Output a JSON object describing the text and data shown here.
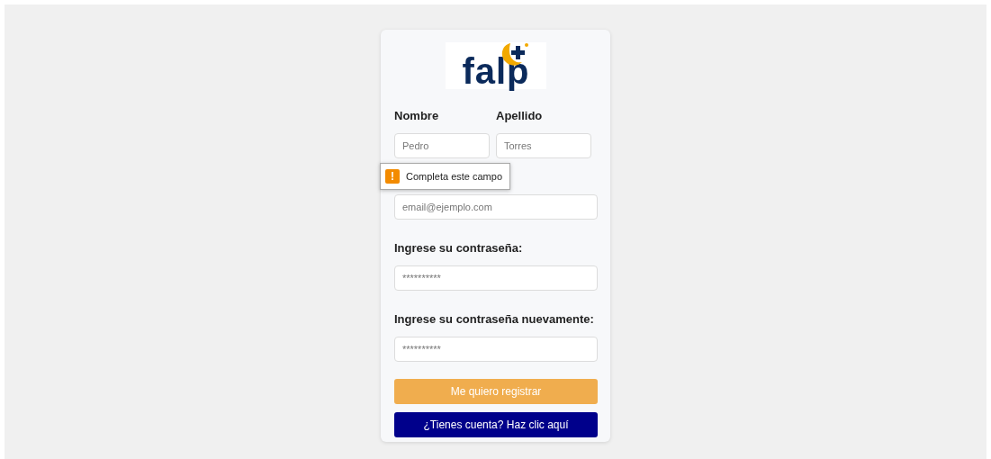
{
  "logo": {
    "text": "falp"
  },
  "name_fields": [
    {
      "label": "Nombre",
      "placeholder": "Pedro"
    },
    {
      "label": "Apellido",
      "placeholder": "Torres"
    }
  ],
  "tooltip": {
    "icon": "!",
    "text": "Completa este campo"
  },
  "fields": [
    {
      "placeholder": "email@ejemplo.com"
    },
    {
      "label": "Ingrese su contraseña:",
      "placeholder": "**********"
    },
    {
      "label": "Ingrese su contraseña nuevamente:",
      "placeholder": "**********"
    }
  ],
  "buttons": [
    {
      "kind": "primary",
      "label": "Me quiero registrar"
    },
    {
      "kind": "secondary",
      "label": "¿Tienes cuenta? Haz clic aquí"
    }
  ]
}
